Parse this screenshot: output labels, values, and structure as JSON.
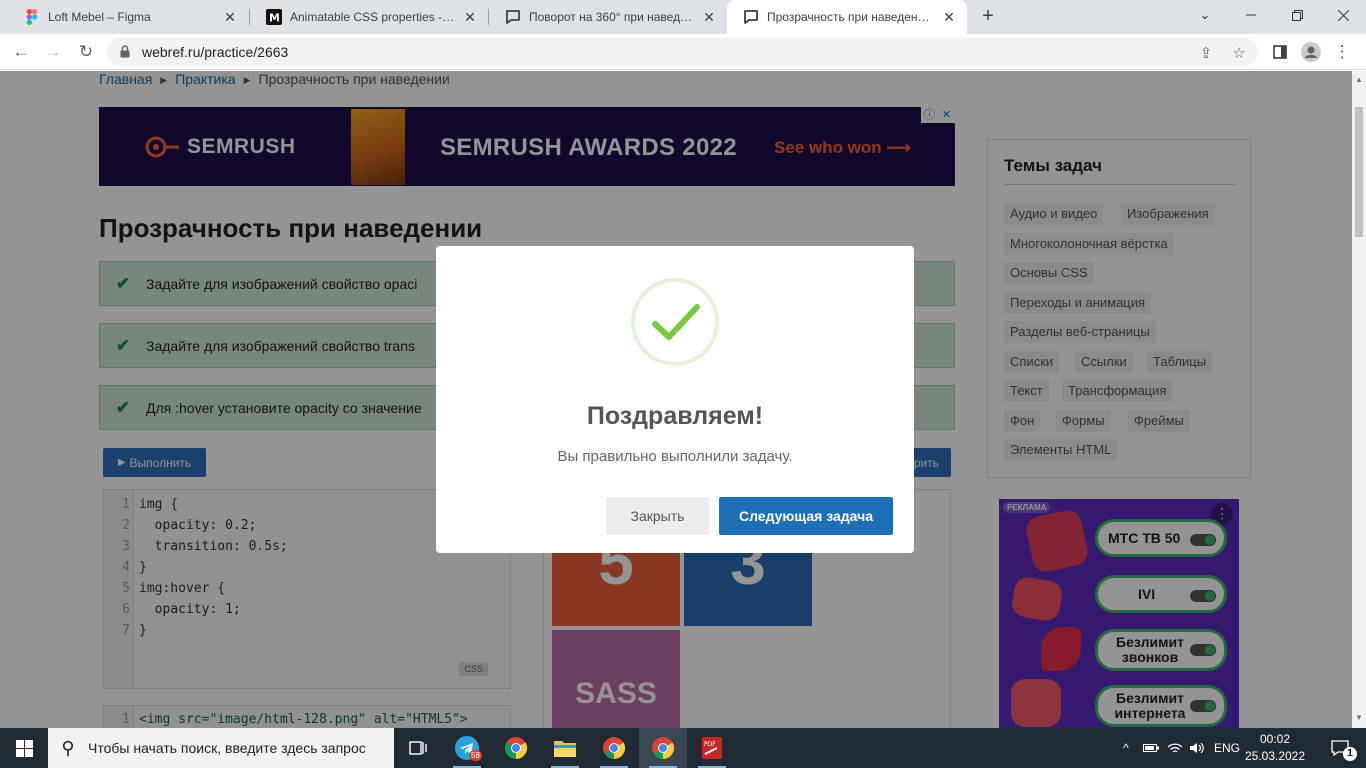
{
  "browser": {
    "tabs": [
      {
        "title": "Loft Mebel – Figma",
        "icon": "figma-icon"
      },
      {
        "title": "Animatable CSS properties - CSS",
        "icon": "mdn-icon"
      },
      {
        "title": "Поворот на 360° при наведении",
        "icon": "speech-bubble-icon"
      },
      {
        "title": "Прозрачность при наведении | ",
        "icon": "speech-bubble-icon",
        "active": true
      }
    ],
    "url": "webref.ru/practice/2663"
  },
  "page": {
    "breadcrumb": [
      "Главная",
      "Практика",
      "Прозрачность при наведении"
    ],
    "ad_banner": {
      "brand": "SEMRUSH",
      "headline": "SEMRUSH AWARDS 2022",
      "cta": "See who won ⟶"
    },
    "title": "Прозрачность при наведении",
    "tasks": [
      "Задайте для изображений свойство opaci",
      "Задайте для изображений свойство trans",
      "Для :hover установите opacity со значение"
    ],
    "run_button": "Выполнить",
    "check_button": "рить",
    "css_editor": {
      "lang": "CSS",
      "lines": [
        "img {",
        "  opacity: 0.2;",
        "  transition: 0.5s;",
        "}",
        "img:hover {",
        "  opacity: 1;",
        "}"
      ]
    },
    "html_editor": {
      "line1": "<img src=\"image/html-128.png\" alt=\"HTML5\">"
    },
    "preview_tiles": [
      "5",
      "3",
      "SASS"
    ]
  },
  "sidebar": {
    "title": "Темы задач",
    "topics": [
      "Аудио и видео",
      "Изображения",
      "Многоколоночная вёрстка",
      "Основы CSS",
      "Переходы и анимация",
      "Разделы веб-страницы",
      "Списки",
      "Ссылки",
      "Таблицы",
      "Текст",
      "Трансформация",
      "Фон",
      "Формы",
      "Фреймы",
      "Элементы HTML"
    ]
  },
  "ad2": {
    "label": "РЕКЛАМА",
    "options": [
      "МТС ТВ 50",
      "IVI",
      "Безлимит звонков",
      "Безлимит интернета"
    ]
  },
  "modal": {
    "title": "Поздравляем!",
    "text": "Вы правильно выполнили задачу.",
    "close_button": "Закрыть",
    "next_button": "Следующая задача",
    "accent": "#1f6fb7",
    "check_color": "#7ac943"
  },
  "taskbar": {
    "search_placeholder": "Чтобы начать поиск, введите здесь запрос",
    "telegram_badge": "58",
    "language": "ENG",
    "time": "00:02",
    "date": "25.03.2022",
    "notifications": "1"
  }
}
